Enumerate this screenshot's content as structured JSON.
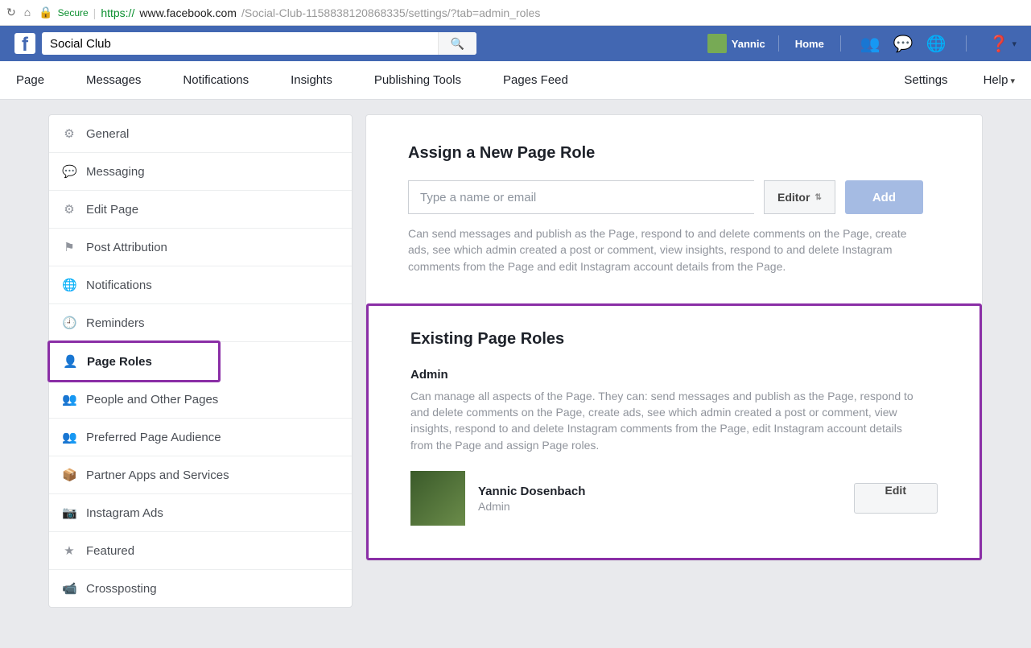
{
  "browser": {
    "secure_label": "Secure",
    "url_proto": "https://",
    "url_host": "www.facebook.com",
    "url_path": "/Social-Club-1158838120868335/settings/?tab=admin_roles"
  },
  "header": {
    "search_value": "Social Club",
    "profile_name": "Yannic",
    "home_label": "Home"
  },
  "page_menu": {
    "left": [
      "Page",
      "Messages",
      "Notifications",
      "Insights",
      "Publishing Tools",
      "Pages Feed"
    ],
    "right": [
      "Settings",
      "Help"
    ]
  },
  "sidebar": [
    {
      "label": "General",
      "icon": "⚙"
    },
    {
      "label": "Messaging",
      "icon": "💬"
    },
    {
      "label": "Edit Page",
      "icon": "⚙"
    },
    {
      "label": "Post Attribution",
      "icon": "⚑"
    },
    {
      "label": "Notifications",
      "icon": "🌐"
    },
    {
      "label": "Reminders",
      "icon": "🕘"
    },
    {
      "label": "Page Roles",
      "icon": "👤",
      "active": true
    },
    {
      "label": "People and Other Pages",
      "icon": "👥"
    },
    {
      "label": "Preferred Page Audience",
      "icon": "👥"
    },
    {
      "label": "Partner Apps and Services",
      "icon": "📦"
    },
    {
      "label": "Instagram Ads",
      "icon": "📷"
    },
    {
      "label": "Featured",
      "icon": "★"
    },
    {
      "label": "Crossposting",
      "icon": "📹"
    }
  ],
  "assign": {
    "title": "Assign a New Page Role",
    "placeholder": "Type a name or email",
    "role_selected": "Editor",
    "add_label": "Add",
    "description": "Can send messages and publish as the Page, respond to and delete comments on the Page, create ads, see which admin created a post or comment, view insights, respond to and delete Instagram comments from the Page and edit Instagram account details from the Page."
  },
  "existing": {
    "title": "Existing Page Roles",
    "role_name": "Admin",
    "role_desc": "Can manage all aspects of the Page. They can: send messages and publish as the Page, respond to and delete comments on the Page, create ads, see which admin created a post or comment, view insights, respond to and delete Instagram comments from the Page, edit Instagram account details from the Page and assign Page roles.",
    "user": {
      "name": "Yannic Dosenbach",
      "role": "Admin"
    },
    "edit_label": "Edit"
  }
}
